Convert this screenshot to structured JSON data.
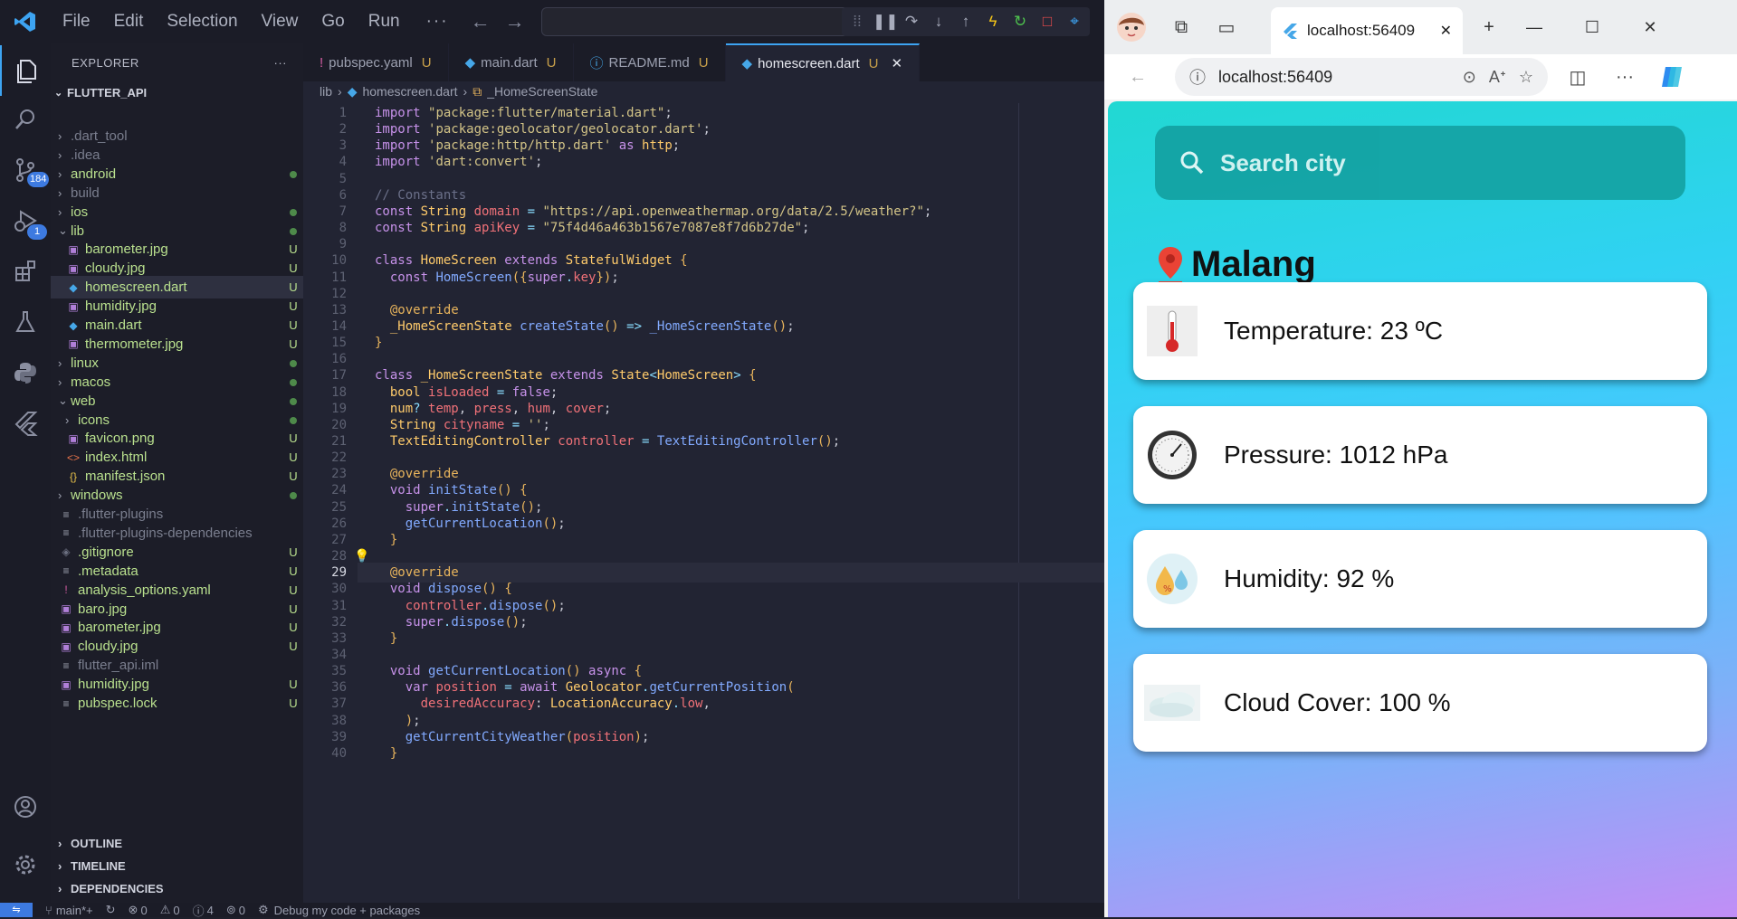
{
  "menu": {
    "file": "File",
    "edit": "Edit",
    "selection": "Selection",
    "view": "View",
    "go": "Go",
    "run": "Run",
    "more": "···"
  },
  "activity": {
    "scm_badge": "184",
    "debug_badge": "1"
  },
  "explorer": {
    "title": "EXPLORER",
    "more": "···",
    "root": "FLUTTER_API",
    "rows": [
      {
        "label": ".dart_tool",
        "depth": 1,
        "kind": "folder",
        "collapsed": true,
        "color": "#7a7e8e",
        "status": ""
      },
      {
        "label": ".idea",
        "depth": 1,
        "kind": "folder",
        "collapsed": true,
        "color": "#7a7e8e",
        "status": ""
      },
      {
        "label": "android",
        "depth": 1,
        "kind": "folder",
        "collapsed": true,
        "color": "#b9e08e",
        "status": "dot"
      },
      {
        "label": "build",
        "depth": 1,
        "kind": "folder",
        "collapsed": true,
        "color": "#7a7e8e",
        "status": ""
      },
      {
        "label": "ios",
        "depth": 1,
        "kind": "folder",
        "collapsed": true,
        "color": "#b9e08e",
        "status": "dot"
      },
      {
        "label": "lib",
        "depth": 1,
        "kind": "folder",
        "collapsed": false,
        "color": "#b9e08e",
        "status": "dot"
      },
      {
        "label": "barometer.jpg",
        "depth": 2,
        "kind": "image",
        "color": "#b9e08e",
        "status": "U"
      },
      {
        "label": "cloudy.jpg",
        "depth": 2,
        "kind": "image",
        "color": "#b9e08e",
        "status": "U"
      },
      {
        "label": "homescreen.dart",
        "depth": 2,
        "kind": "dart",
        "color": "#b9e08e",
        "status": "U",
        "selected": true
      },
      {
        "label": "humidity.jpg",
        "depth": 2,
        "kind": "image",
        "color": "#b9e08e",
        "status": "U"
      },
      {
        "label": "main.dart",
        "depth": 2,
        "kind": "dart",
        "color": "#b9e08e",
        "status": "U"
      },
      {
        "label": "thermometer.jpg",
        "depth": 2,
        "kind": "image",
        "color": "#b9e08e",
        "status": "U"
      },
      {
        "label": "linux",
        "depth": 1,
        "kind": "folder",
        "collapsed": true,
        "color": "#b9e08e",
        "status": "dot"
      },
      {
        "label": "macos",
        "depth": 1,
        "kind": "folder",
        "collapsed": true,
        "color": "#b9e08e",
        "status": "dot"
      },
      {
        "label": "web",
        "depth": 1,
        "kind": "folder",
        "collapsed": false,
        "color": "#b9e08e",
        "status": "dot"
      },
      {
        "label": "icons",
        "depth": 2,
        "kind": "folder",
        "collapsed": true,
        "color": "#b9e08e",
        "status": "dot"
      },
      {
        "label": "favicon.png",
        "depth": 2,
        "kind": "image",
        "color": "#b9e08e",
        "status": "U"
      },
      {
        "label": "index.html",
        "depth": 2,
        "kind": "html",
        "color": "#b9e08e",
        "status": "U"
      },
      {
        "label": "manifest.json",
        "depth": 2,
        "kind": "json",
        "color": "#b9e08e",
        "status": "U"
      },
      {
        "label": "windows",
        "depth": 1,
        "kind": "folder",
        "collapsed": true,
        "color": "#b9e08e",
        "status": "dot"
      },
      {
        "label": ".flutter-plugins",
        "depth": 1,
        "kind": "file",
        "color": "#7a7e8e",
        "status": ""
      },
      {
        "label": ".flutter-plugins-dependencies",
        "depth": 1,
        "kind": "file",
        "color": "#7a7e8e",
        "status": ""
      },
      {
        "label": ".gitignore",
        "depth": 1,
        "kind": "git",
        "color": "#b9e08e",
        "status": "U"
      },
      {
        "label": ".metadata",
        "depth": 1,
        "kind": "file",
        "color": "#b9e08e",
        "status": "U"
      },
      {
        "label": "analysis_options.yaml",
        "depth": 1,
        "kind": "yaml",
        "color": "#b9e08e",
        "status": "U"
      },
      {
        "label": "baro.jpg",
        "depth": 1,
        "kind": "image",
        "color": "#b9e08e",
        "status": "U"
      },
      {
        "label": "barometer.jpg",
        "depth": 1,
        "kind": "image",
        "color": "#b9e08e",
        "status": "U"
      },
      {
        "label": "cloudy.jpg",
        "depth": 1,
        "kind": "image",
        "color": "#b9e08e",
        "status": "U"
      },
      {
        "label": "flutter_api.iml",
        "depth": 1,
        "kind": "file",
        "color": "#7a7e8e",
        "status": ""
      },
      {
        "label": "humidity.jpg",
        "depth": 1,
        "kind": "image",
        "color": "#b9e08e",
        "status": "U"
      },
      {
        "label": "pubspec.lock",
        "depth": 1,
        "kind": "file",
        "color": "#b9e08e",
        "status": "U"
      }
    ],
    "outline": "OUTLINE",
    "timeline": "TIMELINE",
    "dependencies": "DEPENDENCIES"
  },
  "tabs": [
    {
      "label": "pubspec.yaml",
      "icon": "!",
      "iconColor": "#d45ca3",
      "status": "U",
      "active": false
    },
    {
      "label": "main.dart",
      "icon": "◆",
      "iconColor": "#46a7e8",
      "status": "U",
      "active": false
    },
    {
      "label": "README.md",
      "icon": "ⓘ",
      "iconColor": "#46a7e8",
      "status": "U",
      "active": false
    },
    {
      "label": "homescreen.dart",
      "icon": "◆",
      "iconColor": "#46a7e8",
      "status": "U",
      "active": true
    }
  ],
  "breadcrumb": {
    "a": "lib",
    "b": "homescreen.dart",
    "c": "_HomeScreenState"
  },
  "code": {
    "current_line": 29,
    "lines": [
      [
        [
          "k",
          "import "
        ],
        [
          "s",
          "\"package:flutter/material.dart\""
        ],
        [
          "",
          "; "
        ]
      ],
      [
        [
          "k",
          "import "
        ],
        [
          "s",
          "'package:geolocator/geolocator.dart'"
        ],
        [
          "",
          ";"
        ]
      ],
      [
        [
          "k",
          "import "
        ],
        [
          "s",
          "'package:http/http.dart'"
        ],
        [
          "k",
          " as "
        ],
        [
          "t",
          "http"
        ],
        [
          "",
          ";"
        ]
      ],
      [
        [
          "k",
          "import "
        ],
        [
          "s",
          "'dart:convert'"
        ],
        [
          "",
          ";"
        ]
      ],
      [],
      [
        [
          "c",
          "// Constants"
        ]
      ],
      [
        [
          "k",
          "const "
        ],
        [
          "t",
          "String "
        ],
        [
          "v",
          "domain"
        ],
        [
          "o",
          " = "
        ],
        [
          "s",
          "\"https://api.openweathermap.org/data/2.5/weather?\""
        ],
        [
          "",
          ";"
        ]
      ],
      [
        [
          "k",
          "const "
        ],
        [
          "t",
          "String "
        ],
        [
          "v",
          "apiKey"
        ],
        [
          "o",
          " = "
        ],
        [
          "s",
          "\"75f4d46a463b1567e7087e8f7d6b27de\""
        ],
        [
          "",
          ";"
        ]
      ],
      [],
      [
        [
          "k",
          "class "
        ],
        [
          "t",
          "HomeScreen "
        ],
        [
          "k",
          "extends "
        ],
        [
          "t",
          "StatefulWidget "
        ],
        [
          "a",
          "{"
        ]
      ],
      [
        [
          "",
          "  "
        ],
        [
          "k",
          "const "
        ],
        [
          "f",
          "HomeScreen"
        ],
        [
          "a",
          "({"
        ],
        [
          "k",
          "super"
        ],
        [
          "o",
          "."
        ],
        [
          "v",
          "key"
        ],
        [
          "a",
          "})"
        ],
        [
          "",
          ";"
        ]
      ],
      [],
      [
        [
          "",
          "  "
        ],
        [
          "a",
          "@override"
        ]
      ],
      [
        [
          "",
          "  "
        ],
        [
          "t",
          "_HomeScreenState "
        ],
        [
          "f",
          "createState"
        ],
        [
          "a",
          "() "
        ],
        [
          "o",
          "=> "
        ],
        [
          "f",
          "_HomeScreenState"
        ],
        [
          "a",
          "()"
        ],
        [
          "",
          ";"
        ]
      ],
      [
        [
          "a",
          "}"
        ]
      ],
      [],
      [
        [
          "k",
          "class "
        ],
        [
          "t",
          "_HomeScreenState "
        ],
        [
          "k",
          "extends "
        ],
        [
          "t",
          "State"
        ],
        [
          "o",
          "<"
        ],
        [
          "t",
          "HomeScreen"
        ],
        [
          "o",
          "> "
        ],
        [
          "a",
          "{"
        ]
      ],
      [
        [
          "",
          "  "
        ],
        [
          "t",
          "bool "
        ],
        [
          "v",
          "isLoaded"
        ],
        [
          "o",
          " = "
        ],
        [
          "k",
          "false"
        ],
        [
          "",
          ";"
        ]
      ],
      [
        [
          "",
          "  "
        ],
        [
          "t",
          "num"
        ],
        [
          "o",
          "? "
        ],
        [
          "v",
          "temp"
        ],
        [
          "",
          ", "
        ],
        [
          "v",
          "press"
        ],
        [
          "",
          ", "
        ],
        [
          "v",
          "hum"
        ],
        [
          "",
          ", "
        ],
        [
          "v",
          "cover"
        ],
        [
          "",
          ";"
        ]
      ],
      [
        [
          "",
          "  "
        ],
        [
          "t",
          "String "
        ],
        [
          "v",
          "cityname"
        ],
        [
          "o",
          " = "
        ],
        [
          "s",
          "''"
        ],
        [
          "",
          ";"
        ]
      ],
      [
        [
          "",
          "  "
        ],
        [
          "t",
          "TextEditingController "
        ],
        [
          "v",
          "controller"
        ],
        [
          "o",
          " = "
        ],
        [
          "f",
          "TextEditingController"
        ],
        [
          "a",
          "()"
        ],
        [
          "",
          ";"
        ]
      ],
      [],
      [
        [
          "",
          "  "
        ],
        [
          "a",
          "@override"
        ]
      ],
      [
        [
          "",
          "  "
        ],
        [
          "k",
          "void "
        ],
        [
          "f",
          "initState"
        ],
        [
          "a",
          "() {"
        ]
      ],
      [
        [
          "",
          "    "
        ],
        [
          "k",
          "super"
        ],
        [
          "o",
          "."
        ],
        [
          "f",
          "initState"
        ],
        [
          "a",
          "()"
        ],
        [
          "",
          ";"
        ]
      ],
      [
        [
          "",
          "    "
        ],
        [
          "f",
          "getCurrentLocation"
        ],
        [
          "a",
          "()"
        ],
        [
          "",
          ";"
        ]
      ],
      [
        [
          "",
          "  "
        ],
        [
          "a",
          "}"
        ]
      ],
      [],
      [
        [
          "",
          "  "
        ],
        [
          "a",
          "@override"
        ]
      ],
      [
        [
          "",
          "  "
        ],
        [
          "k",
          "void "
        ],
        [
          "f",
          "dispose"
        ],
        [
          "a",
          "() {"
        ]
      ],
      [
        [
          "",
          "    "
        ],
        [
          "v",
          "controller"
        ],
        [
          "o",
          "."
        ],
        [
          "f",
          "dispose"
        ],
        [
          "a",
          "()"
        ],
        [
          "",
          ";"
        ]
      ],
      [
        [
          "",
          "    "
        ],
        [
          "k",
          "super"
        ],
        [
          "o",
          "."
        ],
        [
          "f",
          "dispose"
        ],
        [
          "a",
          "()"
        ],
        [
          "",
          ";"
        ]
      ],
      [
        [
          "",
          "  "
        ],
        [
          "a",
          "}"
        ]
      ],
      [],
      [
        [
          "",
          "  "
        ],
        [
          "k",
          "void "
        ],
        [
          "f",
          "getCurrentLocation"
        ],
        [
          "a",
          "() "
        ],
        [
          "k",
          "async "
        ],
        [
          "a",
          "{"
        ]
      ],
      [
        [
          "",
          "    "
        ],
        [
          "k",
          "var "
        ],
        [
          "v",
          "position"
        ],
        [
          "o",
          " = "
        ],
        [
          "k",
          "await "
        ],
        [
          "t",
          "Geolocator"
        ],
        [
          "o",
          "."
        ],
        [
          "f",
          "getCurrentPosition"
        ],
        [
          "a",
          "("
        ]
      ],
      [
        [
          "",
          "      "
        ],
        [
          "v",
          "desiredAccuracy"
        ],
        [
          "",
          ": "
        ],
        [
          "t",
          "LocationAccuracy"
        ],
        [
          "o",
          "."
        ],
        [
          "v",
          "low"
        ],
        [
          "",
          ","
        ]
      ],
      [
        [
          "",
          "    "
        ],
        [
          "a",
          ")"
        ],
        [
          "",
          ";"
        ]
      ],
      [
        [
          "",
          "    "
        ],
        [
          "f",
          "getCurrentCityWeather"
        ],
        [
          "a",
          "("
        ],
        [
          "v",
          "position"
        ],
        [
          "a",
          ")"
        ],
        [
          "",
          ";"
        ]
      ],
      [
        [
          "",
          "  "
        ],
        [
          "a",
          "}"
        ]
      ]
    ]
  },
  "status": {
    "branch": "main*+",
    "errors": "0",
    "warnings": "0",
    "info": "4",
    "ports": "0",
    "debug": "Debug my code + packages"
  },
  "browser": {
    "tab_title": "localhost:56409",
    "url": "localhost:56409"
  },
  "app": {
    "search_placeholder": "Search city",
    "city": "Malang",
    "cards": [
      {
        "label": "Temperature: 23 ºC",
        "icon": "thermometer-icon"
      },
      {
        "label": "Pressure: 1012 hPa",
        "icon": "barometer-icon"
      },
      {
        "label": "Humidity: 92 %",
        "icon": "humidity-icon"
      },
      {
        "label": "Cloud Cover: 100 %",
        "icon": "cloud-icon"
      }
    ]
  }
}
